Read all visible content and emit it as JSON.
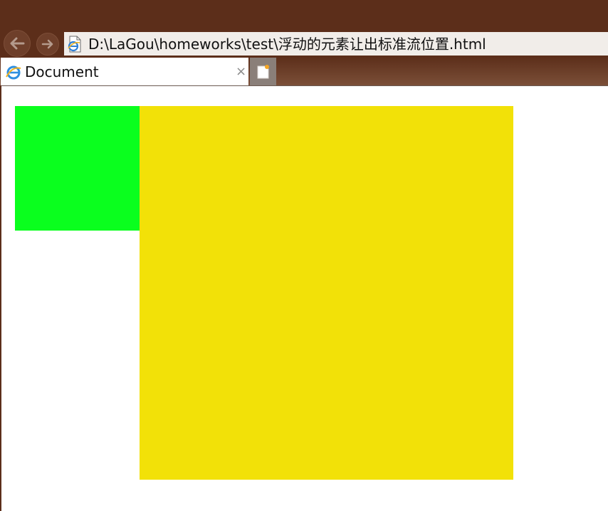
{
  "browser": {
    "address": "D:\\LaGou\\homeworks\\test\\浮动的元素让出标准流位置.html",
    "tab_title": "Document",
    "tab_close": "×",
    "icons": {
      "back": "back-arrow-icon",
      "forward": "forward-arrow-icon",
      "page": "ie-page-icon",
      "tab": "ie-logo-icon",
      "new_tab": "new-tab-icon"
    },
    "colors": {
      "chrome": "#5c2e1a"
    }
  },
  "page": {
    "green_box_color": "#0aff1e",
    "yellow_box_color": "#f2e108"
  }
}
